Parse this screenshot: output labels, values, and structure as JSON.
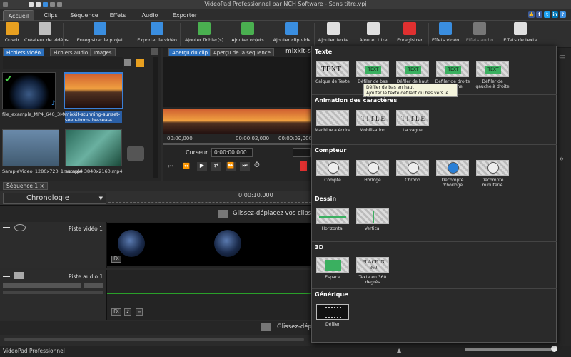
{
  "window": {
    "title": "VideoPad Professionnel par NCH Software - Sans titre.vpj"
  },
  "menu": {
    "tabs": [
      "Accueil",
      "Clips",
      "Séquence",
      "Effets",
      "Audio",
      "Exporter"
    ],
    "active": 0
  },
  "toolbar": {
    "buttons": [
      {
        "label": "Ouvrir",
        "icon": "folder-open-icon",
        "color": "#e8a020"
      },
      {
        "label": "Créateur de vidéos",
        "icon": "magic-wand-icon",
        "color": "#c0c0c0"
      },
      {
        "label": "Enregistrer le projet",
        "icon": "save-project-icon",
        "color": "#3a8ee0"
      },
      {
        "label": "Exporter la vidéo",
        "icon": "export-video-icon",
        "color": "#3a8ee0"
      },
      {
        "label": "Ajouter fichier(s)",
        "icon": "add-file-icon",
        "color": "#4ab050"
      },
      {
        "label": "Ajouter objets",
        "icon": "add-objects-icon",
        "color": "#4ab050"
      },
      {
        "label": "Ajouter clip vide",
        "icon": "add-blank-clip-icon",
        "color": "#3a8ee0"
      },
      {
        "label": "Ajouter texte",
        "icon": "add-text-icon",
        "color": "#e0e0e0"
      },
      {
        "label": "Ajouter titre",
        "icon": "add-title-icon",
        "color": "#e0e0e0"
      },
      {
        "label": "Enregistrer",
        "icon": "record-icon",
        "color": "#e03030"
      },
      {
        "label": "Effets vidéo",
        "icon": "video-effects-icon",
        "color": "#3a8ee0"
      },
      {
        "label": "Effets audio",
        "icon": "audio-effects-icon",
        "color": "#777777"
      },
      {
        "label": "Effets de texte",
        "icon": "text-effects-icon",
        "color": "#e0e0e0"
      }
    ]
  },
  "media": {
    "tabs": [
      "Fichiers vidéo",
      "Fichiers audio",
      "Images"
    ],
    "clips": [
      {
        "name": "file_example_MP4_640_3MG.mp4",
        "color": "#10203a"
      },
      {
        "name": "mixkit-stunning-sunset-seen-from-the-sea-4...",
        "color": "#d07030"
      },
      {
        "name": "SampleVideo_1280x720_1mb.mp4",
        "color": "#507090"
      },
      {
        "name": "sample_3840x2160.mp4",
        "color": "#2a6a5a"
      }
    ]
  },
  "preview": {
    "tabs": [
      "Aperçu du clip",
      "Aperçu de la séquence"
    ],
    "clip_title": "mixkit-st",
    "times": [
      "00:00,000",
      "00:00:02,000",
      "00:00:03,000"
    ],
    "cursor_label": "Curseur :",
    "cursor_value": "0:00:00.000"
  },
  "timeline": {
    "seq_tab": "Séquence 1",
    "mode": "Chronologie",
    "ruler_time": "0:00:10.000",
    "drop_hint": "Glissez-déplacez vos clips v",
    "drop_hint_audio": "Glissez-dépl",
    "video_track": "Piste vidéo 1",
    "audio_track": "Piste audio 1",
    "fx": "FX"
  },
  "popup": {
    "sections": [
      {
        "title": "Texte",
        "items": [
          "Calque de Texte",
          "Défiler de bas en haut",
          "Défiler de haut en bas",
          "Défiler de droite à gauche",
          "Défiler de gauche à droite"
        ]
      },
      {
        "title": "Animation des caractères",
        "items": [
          "Machine à écrire",
          "Mobilisation",
          "La vague"
        ]
      },
      {
        "title": "Compteur",
        "items": [
          "Compte",
          "Horloge",
          "Chrono",
          "Décompte d'horloge",
          "Décompte minuterie"
        ]
      },
      {
        "title": "Dessin",
        "items": [
          "Horizontal",
          "Vertical"
        ]
      },
      {
        "title": "3D",
        "items": [
          "Espace",
          "Texte en 360 degrés"
        ]
      },
      {
        "title": "Générique",
        "items": [
          "Défiler"
        ]
      }
    ],
    "tooltip": {
      "title": "Défiler de bas en haut",
      "desc": "Ajouter le texte défilant du bas vers le haut"
    },
    "thumb_texts": {
      "text": "TEXT",
      "title": "TITLE",
      "place": "PLACE IN 360"
    }
  },
  "status": {
    "text": "VideoPad Professionnel"
  },
  "colors": {
    "accent": "#2a6fbd",
    "record": "#e03030"
  }
}
